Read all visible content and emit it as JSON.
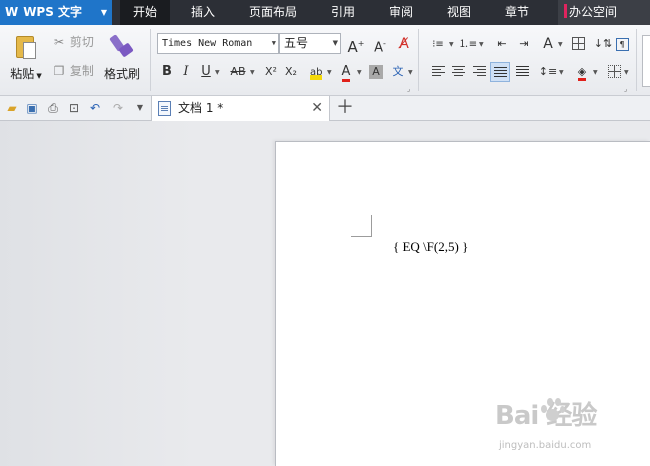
{
  "app": {
    "name": "WPS 文字",
    "logo": "W"
  },
  "menu": {
    "tabs": [
      "开始",
      "插入",
      "页面布局",
      "引用",
      "审阅",
      "视图",
      "章节"
    ],
    "active": "开始",
    "office_space": "办公空间"
  },
  "ribbon": {
    "clipboard": {
      "paste": "粘贴",
      "cut": "剪切",
      "copy": "复制",
      "format_painter": "格式刷"
    },
    "font": {
      "family": "Times New Roman",
      "size": "五号",
      "bold": "B",
      "italic": "I",
      "underline": "U",
      "strike": "AB",
      "superscript": "X²",
      "subscript": "X₂",
      "font_color_letter": "A",
      "char_shade_letter": "A",
      "phonetic": "文"
    },
    "colors": {
      "highlight": "#f5d90a",
      "font_color": "#e0201a",
      "shading": "#a9a9a9",
      "fill": "#e0201a"
    }
  },
  "document": {
    "tab_title": "文档 1 *",
    "field_code": "{ EQ \\F(2,5) }"
  },
  "watermark": {
    "main": "Bai  经验",
    "sub": "jingyan.baidu.com"
  }
}
